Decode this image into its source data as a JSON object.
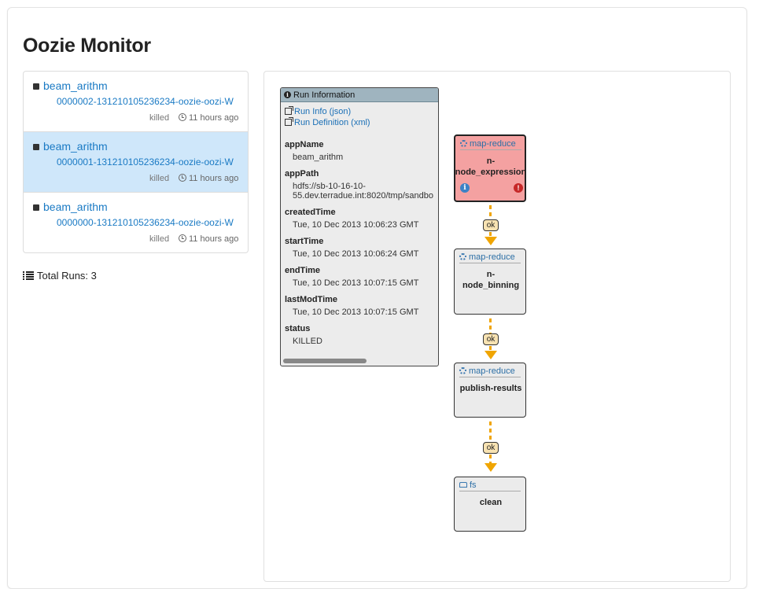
{
  "page": {
    "title": "Oozie Monitor"
  },
  "runs": [
    {
      "name": "beam_arithm",
      "id": "0000002-131210105236234-oozie-oozi-W",
      "status": "killed",
      "time": "11 hours ago"
    },
    {
      "name": "beam_arithm",
      "id": "0000001-131210105236234-oozie-oozi-W",
      "status": "killed",
      "time": "11 hours ago",
      "selected": true
    },
    {
      "name": "beam_arithm",
      "id": "0000000-131210105236234-oozie-oozi-W",
      "status": "killed",
      "time": "11 hours ago"
    }
  ],
  "total_runs": "Total Runs: 3",
  "run_info": {
    "header": "Run Information",
    "links": {
      "json": "Run Info (json)",
      "xml": "Run Definition (xml)"
    },
    "fields": {
      "appName": {
        "label": "appName",
        "value": "beam_arithm"
      },
      "appPath": {
        "label": "appPath",
        "value_line1": "hdfs://sb-10-16-10-",
        "value_line2": "55.dev.terradue.int:8020/tmp/sandbo"
      },
      "createdTime": {
        "label": "createdTime",
        "value": "Tue, 10 Dec 2013 10:06:23 GMT"
      },
      "startTime": {
        "label": "startTime",
        "value": "Tue, 10 Dec 2013 10:06:24 GMT"
      },
      "endTime": {
        "label": "endTime",
        "value": "Tue, 10 Dec 2013 10:07:15 GMT"
      },
      "lastModTime": {
        "label": "lastModTime",
        "value": "Tue, 10 Dec 2013 10:07:15 GMT"
      },
      "status": {
        "label": "status",
        "value": "KILLED"
      }
    }
  },
  "workflow": {
    "nodes": [
      {
        "type": "map-reduce",
        "name_line1": "n-",
        "name_line2": "node_expression",
        "state": "error"
      },
      {
        "type": "map-reduce",
        "name_line1": "n-",
        "name_line2": "node_binning",
        "state": "normal"
      },
      {
        "type": "map-reduce",
        "name_line1": "publish-results",
        "name_line2": "",
        "state": "normal"
      },
      {
        "type": "fs",
        "name_line1": "clean",
        "name_line2": "",
        "state": "normal"
      }
    ],
    "edges": [
      {
        "label": "ok"
      },
      {
        "label": "ok"
      },
      {
        "label": "ok"
      }
    ]
  },
  "colors": {
    "link": "#1a7ac4",
    "selected_row": "#cfe7fa",
    "error_node": "#f4a1a1",
    "edge": "#f0a500",
    "info_header": "#9fb4bf"
  },
  "icons": {
    "list": "list-icon",
    "clock": "clock-icon",
    "info": "info-icon",
    "external_link": "external-link-icon",
    "gear": "gears-icon",
    "fs": "hdd-icon",
    "error": "exclamation-icon"
  }
}
